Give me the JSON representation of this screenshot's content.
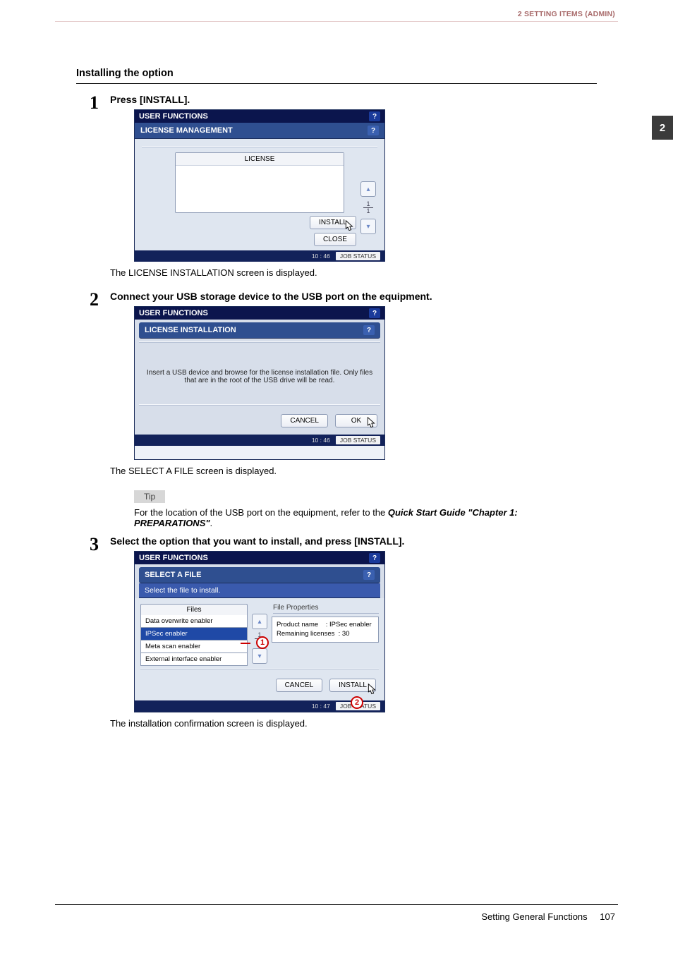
{
  "running_head": "2 SETTING ITEMS (ADMIN)",
  "side_tab": "2",
  "section_heading": "Installing the option",
  "steps": {
    "s1": {
      "num": "1",
      "title": "Press [INSTALL].",
      "after_note": "The LICENSE INSTALLATION screen is displayed."
    },
    "s2": {
      "num": "2",
      "title": "Connect your USB storage device to the USB port on the equipment.",
      "after_note": "The SELECT A FILE screen is displayed."
    },
    "s3": {
      "num": "3",
      "title": "Select the option that you want to install, and press [INSTALL].",
      "after_note": "The installation confirmation screen is displayed."
    }
  },
  "tip": {
    "label": "Tip",
    "text_pre": "For the location of the USB port on the equipment, refer to the ",
    "text_bold": "Quick Start Guide \"Chapter 1: PREPARATIONS\"",
    "text_post": "."
  },
  "screens": {
    "header_title": "USER FUNCTIONS",
    "help": "?",
    "time1": "10 : 46",
    "time3": "10 : 47",
    "job_status": "JOB STATUS",
    "s1": {
      "subheader": "LICENSE MANAGEMENT",
      "col_license": "LICENSE",
      "page_num": "1",
      "page_den": "1",
      "install": "INSTALL",
      "close": "CLOSE"
    },
    "s2": {
      "subheader": "LICENSE  INSTALLATION",
      "message": "Insert a USB device and browse for the license installation file. Only files that are in the root of the USB drive will be read.",
      "cancel": "CANCEL",
      "ok": "OK"
    },
    "s3": {
      "subheader": "SELECT A FILE",
      "bread": "Select the file to install.",
      "files_header": "Files",
      "files": [
        "Data overwrite enabler",
        "IPSec enabler",
        "Meta scan enabler",
        "External interface enabler"
      ],
      "page_num": "1",
      "page_den": "1",
      "props_title": "File Properties",
      "prop_product_label": "Product name",
      "prop_product_value": ": IPSec enabler",
      "prop_remaining_label": "Remaining licenses",
      "prop_remaining_value": ": 30",
      "cancel": "CANCEL",
      "install": "INSTALL",
      "callout1": "1",
      "callout2": "2"
    }
  },
  "footer": {
    "section": "Setting General Functions",
    "page": "107"
  }
}
